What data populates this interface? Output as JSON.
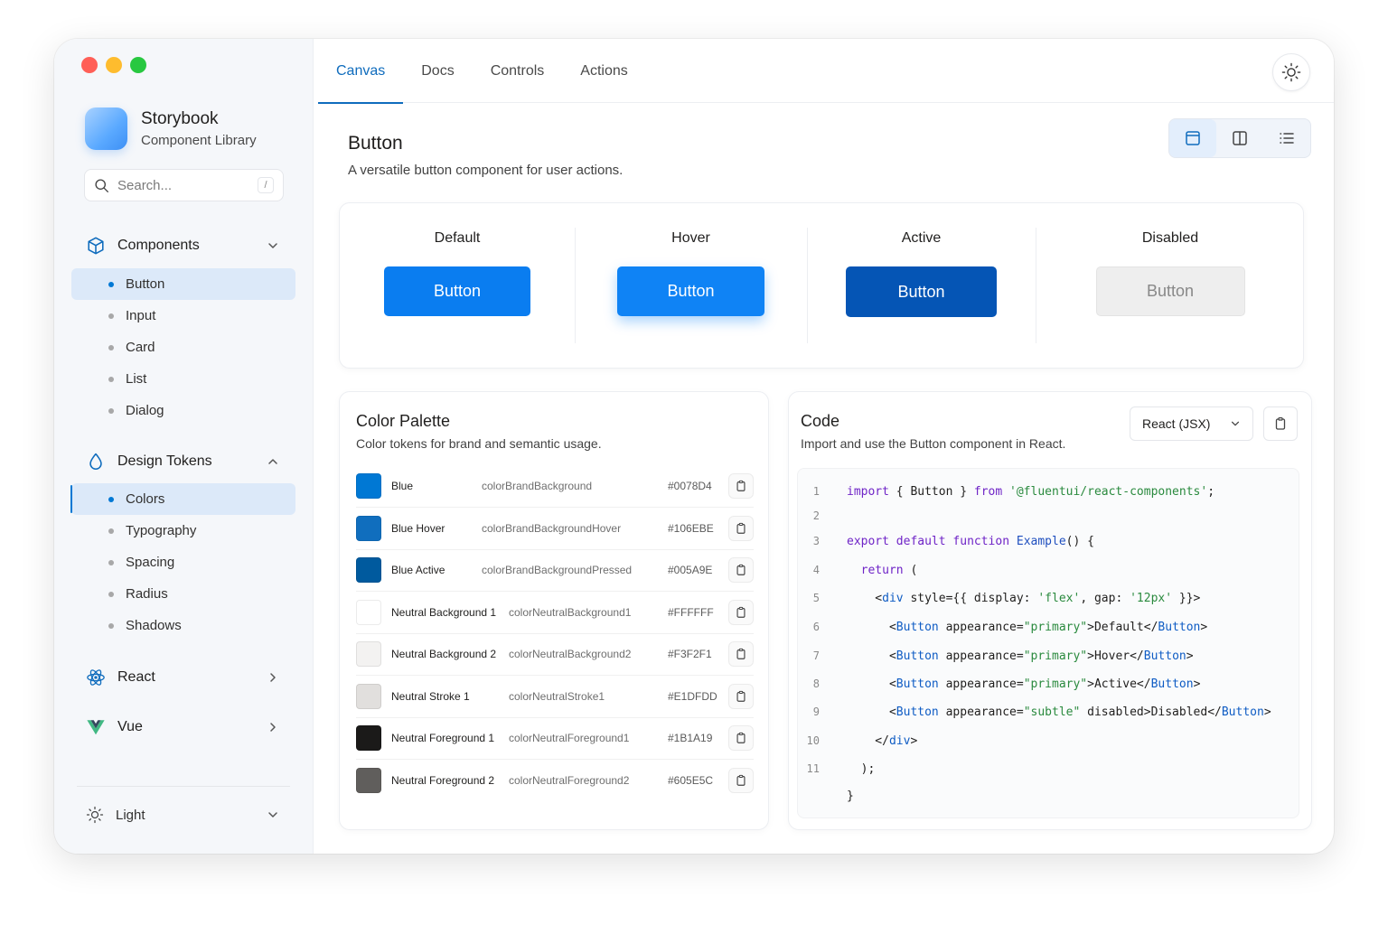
{
  "window": {
    "traffic_lights": [
      "#ff5f57",
      "#febc2e",
      "#28c840"
    ]
  },
  "brand": {
    "title": "Storybook",
    "subtitle": "Component Library"
  },
  "search": {
    "placeholder": "Search...",
    "shortcut": "/"
  },
  "sidebar": {
    "groups": [
      {
        "label": "Components",
        "icon": "cube-icon",
        "expanded": true,
        "items": [
          "Button",
          "Input",
          "Card",
          "List",
          "Dialog"
        ],
        "active": "Button"
      },
      {
        "label": "Design Tokens",
        "icon": "droplet-icon",
        "expanded": true,
        "items": [
          "Colors",
          "Typography",
          "Spacing",
          "Radius",
          "Shadows"
        ],
        "active": "Colors"
      },
      {
        "label": "React",
        "icon": "react-icon",
        "expanded": false
      },
      {
        "label": "Vue",
        "icon": "vue-icon",
        "expanded": false
      }
    ],
    "footer": {
      "label": "Light",
      "icon": "sun-icon"
    }
  },
  "tabs": [
    {
      "label": "Canvas",
      "active": true
    },
    {
      "label": "Docs"
    },
    {
      "label": "Controls"
    },
    {
      "label": "Actions"
    }
  ],
  "page": {
    "title": "Button",
    "description": "A versatile button component for user actions."
  },
  "view_modes": [
    "single-panel-icon",
    "split-panel-icon",
    "list-view-icon"
  ],
  "states": [
    {
      "label": "Default",
      "button": "Button"
    },
    {
      "label": "Hover",
      "button": "Button"
    },
    {
      "label": "Active",
      "button": "Button"
    },
    {
      "label": "Disabled",
      "button": "Button"
    }
  ],
  "palette": {
    "title": "Color Palette",
    "description": "Color tokens for brand and semantic usage.",
    "rows": [
      {
        "name": "Blue",
        "token": "colorBrandBackground",
        "hex": "#0078D4"
      },
      {
        "name": "Blue Hover",
        "token": "colorBrandBackgroundHover",
        "hex": "#106EBE"
      },
      {
        "name": "Blue Active",
        "token": "colorBrandBackgroundPressed",
        "hex": "#005A9E"
      },
      {
        "name": "Neutral Background 1",
        "token": "colorNeutralBackground1",
        "hex": "#FFFFFF"
      },
      {
        "name": "Neutral Background 2",
        "token": "colorNeutralBackground2",
        "hex": "#F3F2F1"
      },
      {
        "name": "Neutral Stroke 1",
        "token": "colorNeutralStroke1",
        "hex": "#E1DFDD"
      },
      {
        "name": "Neutral Foreground 1",
        "token": "colorNeutralForeground1",
        "hex": "#1B1A19"
      },
      {
        "name": "Neutral Foreground 2",
        "token": "colorNeutralForeground2",
        "hex": "#605E5C"
      }
    ]
  },
  "code": {
    "title": "Code",
    "description": "Import and use the Button component in React.",
    "language": "React (JSX)",
    "lines": [
      {
        "n": "1",
        "text": "import { Button } from '@fluentui/react-components';"
      },
      {
        "n": "2",
        "text": ""
      },
      {
        "n": "3",
        "text": "export default function Example() {"
      },
      {
        "n": "4",
        "text": "  return ("
      },
      {
        "n": "5",
        "text": "    <div style={{ display: 'flex', gap: '12px' }}>"
      },
      {
        "n": "6",
        "text": "      <Button appearance=\"primary\">Default</Button>"
      },
      {
        "n": "7",
        "text": "      <Button appearance=\"primary\">Hover</Button>"
      },
      {
        "n": "8",
        "text": "      <Button appearance=\"primary\">Active</Button>"
      },
      {
        "n": "9",
        "text": "      <Button appearance=\"subtle\" disabled>Disabled</Button>"
      },
      {
        "n": "10",
        "text": "    </div>"
      },
      {
        "n": "11",
        "text": "  );"
      },
      {
        "n": "",
        "text": "}"
      }
    ]
  }
}
